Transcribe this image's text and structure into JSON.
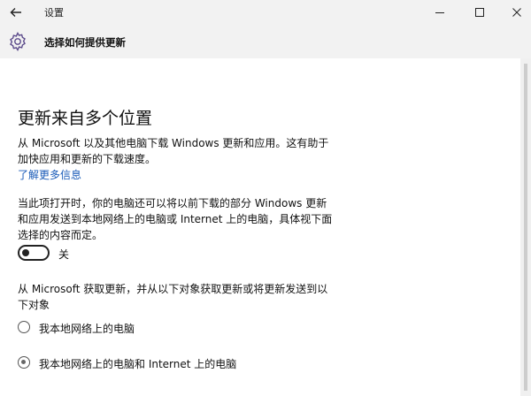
{
  "window": {
    "title": "设置",
    "back_icon": "arrow-left-icon",
    "controls": [
      "minimize-icon",
      "maximize-icon",
      "close-icon"
    ]
  },
  "header": {
    "icon": "gear-icon",
    "title": "选择如何提供更新"
  },
  "main": {
    "heading": "更新来自多个位置",
    "intro_line1": "从 Microsoft 以及其他电脑下载 Windows 更新和应用。这有助于",
    "intro_line2": "加快应用和更新的下载速度。",
    "learn_more": "了解更多信息",
    "desc_line1": "当此项打开时，你的电脑还可以将以前下载的部分 Windows 更新",
    "desc_line2": "和应用发送到本地网络上的电脑或 Internet 上的电脑，具体视下面",
    "desc_line3": "选择的内容而定。",
    "toggle": {
      "state": "off",
      "label": "关"
    },
    "source_line1": "从 Microsoft 获取更新，并从以下对象获取更新或将更新发送到以",
    "source_line2": "下对象",
    "options": [
      {
        "label": "我本地网络上的电脑",
        "selected": false
      },
      {
        "label": "我本地网络上的电脑和 Internet 上的电脑",
        "selected": true
      }
    ]
  },
  "colors": {
    "titlebar_bg": "#f2f2f2",
    "link": "#1a5bb8"
  }
}
